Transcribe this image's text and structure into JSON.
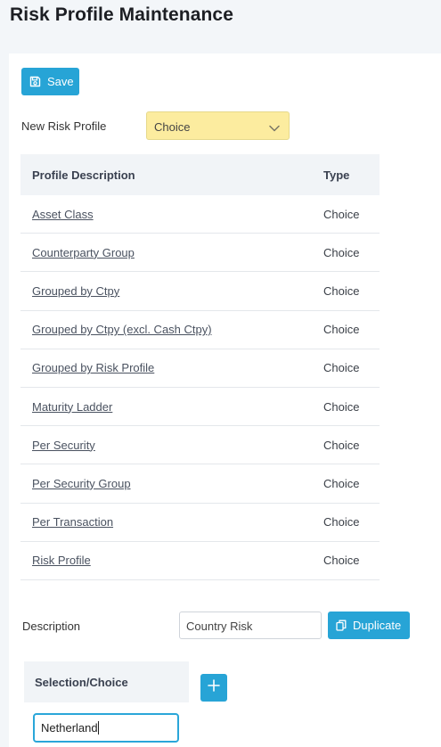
{
  "page": {
    "title": "Risk Profile Maintenance"
  },
  "toolbar": {
    "save_label": "Save"
  },
  "new_profile": {
    "label": "New Risk Profile",
    "selected": "Choice"
  },
  "table": {
    "headers": {
      "description": "Profile Description",
      "type": "Type"
    },
    "rows": [
      {
        "description": "Asset Class",
        "type": "Choice"
      },
      {
        "description": "Counterparty Group",
        "type": "Choice"
      },
      {
        "description": "Grouped by Ctpy",
        "type": "Choice"
      },
      {
        "description": "Grouped by Ctpy (excl. Cash Ctpy)",
        "type": "Choice"
      },
      {
        "description": "Grouped by Risk Profile",
        "type": "Choice"
      },
      {
        "description": "Maturity Ladder",
        "type": "Choice"
      },
      {
        "description": "Per Security",
        "type": "Choice"
      },
      {
        "description": "Per Security Group",
        "type": "Choice"
      },
      {
        "description": "Per Transaction",
        "type": "Choice"
      },
      {
        "description": "Risk Profile",
        "type": "Choice"
      }
    ]
  },
  "description": {
    "label": "Description",
    "value": "Country Risk",
    "duplicate_label": "Duplicate"
  },
  "selection": {
    "header": "Selection/Choice",
    "add_icon": "plus-icon",
    "input_value": "Netherland"
  },
  "colors": {
    "accent": "#27a4d6",
    "select_bg": "#fcec9f",
    "header_bg": "#f1f4f7"
  }
}
